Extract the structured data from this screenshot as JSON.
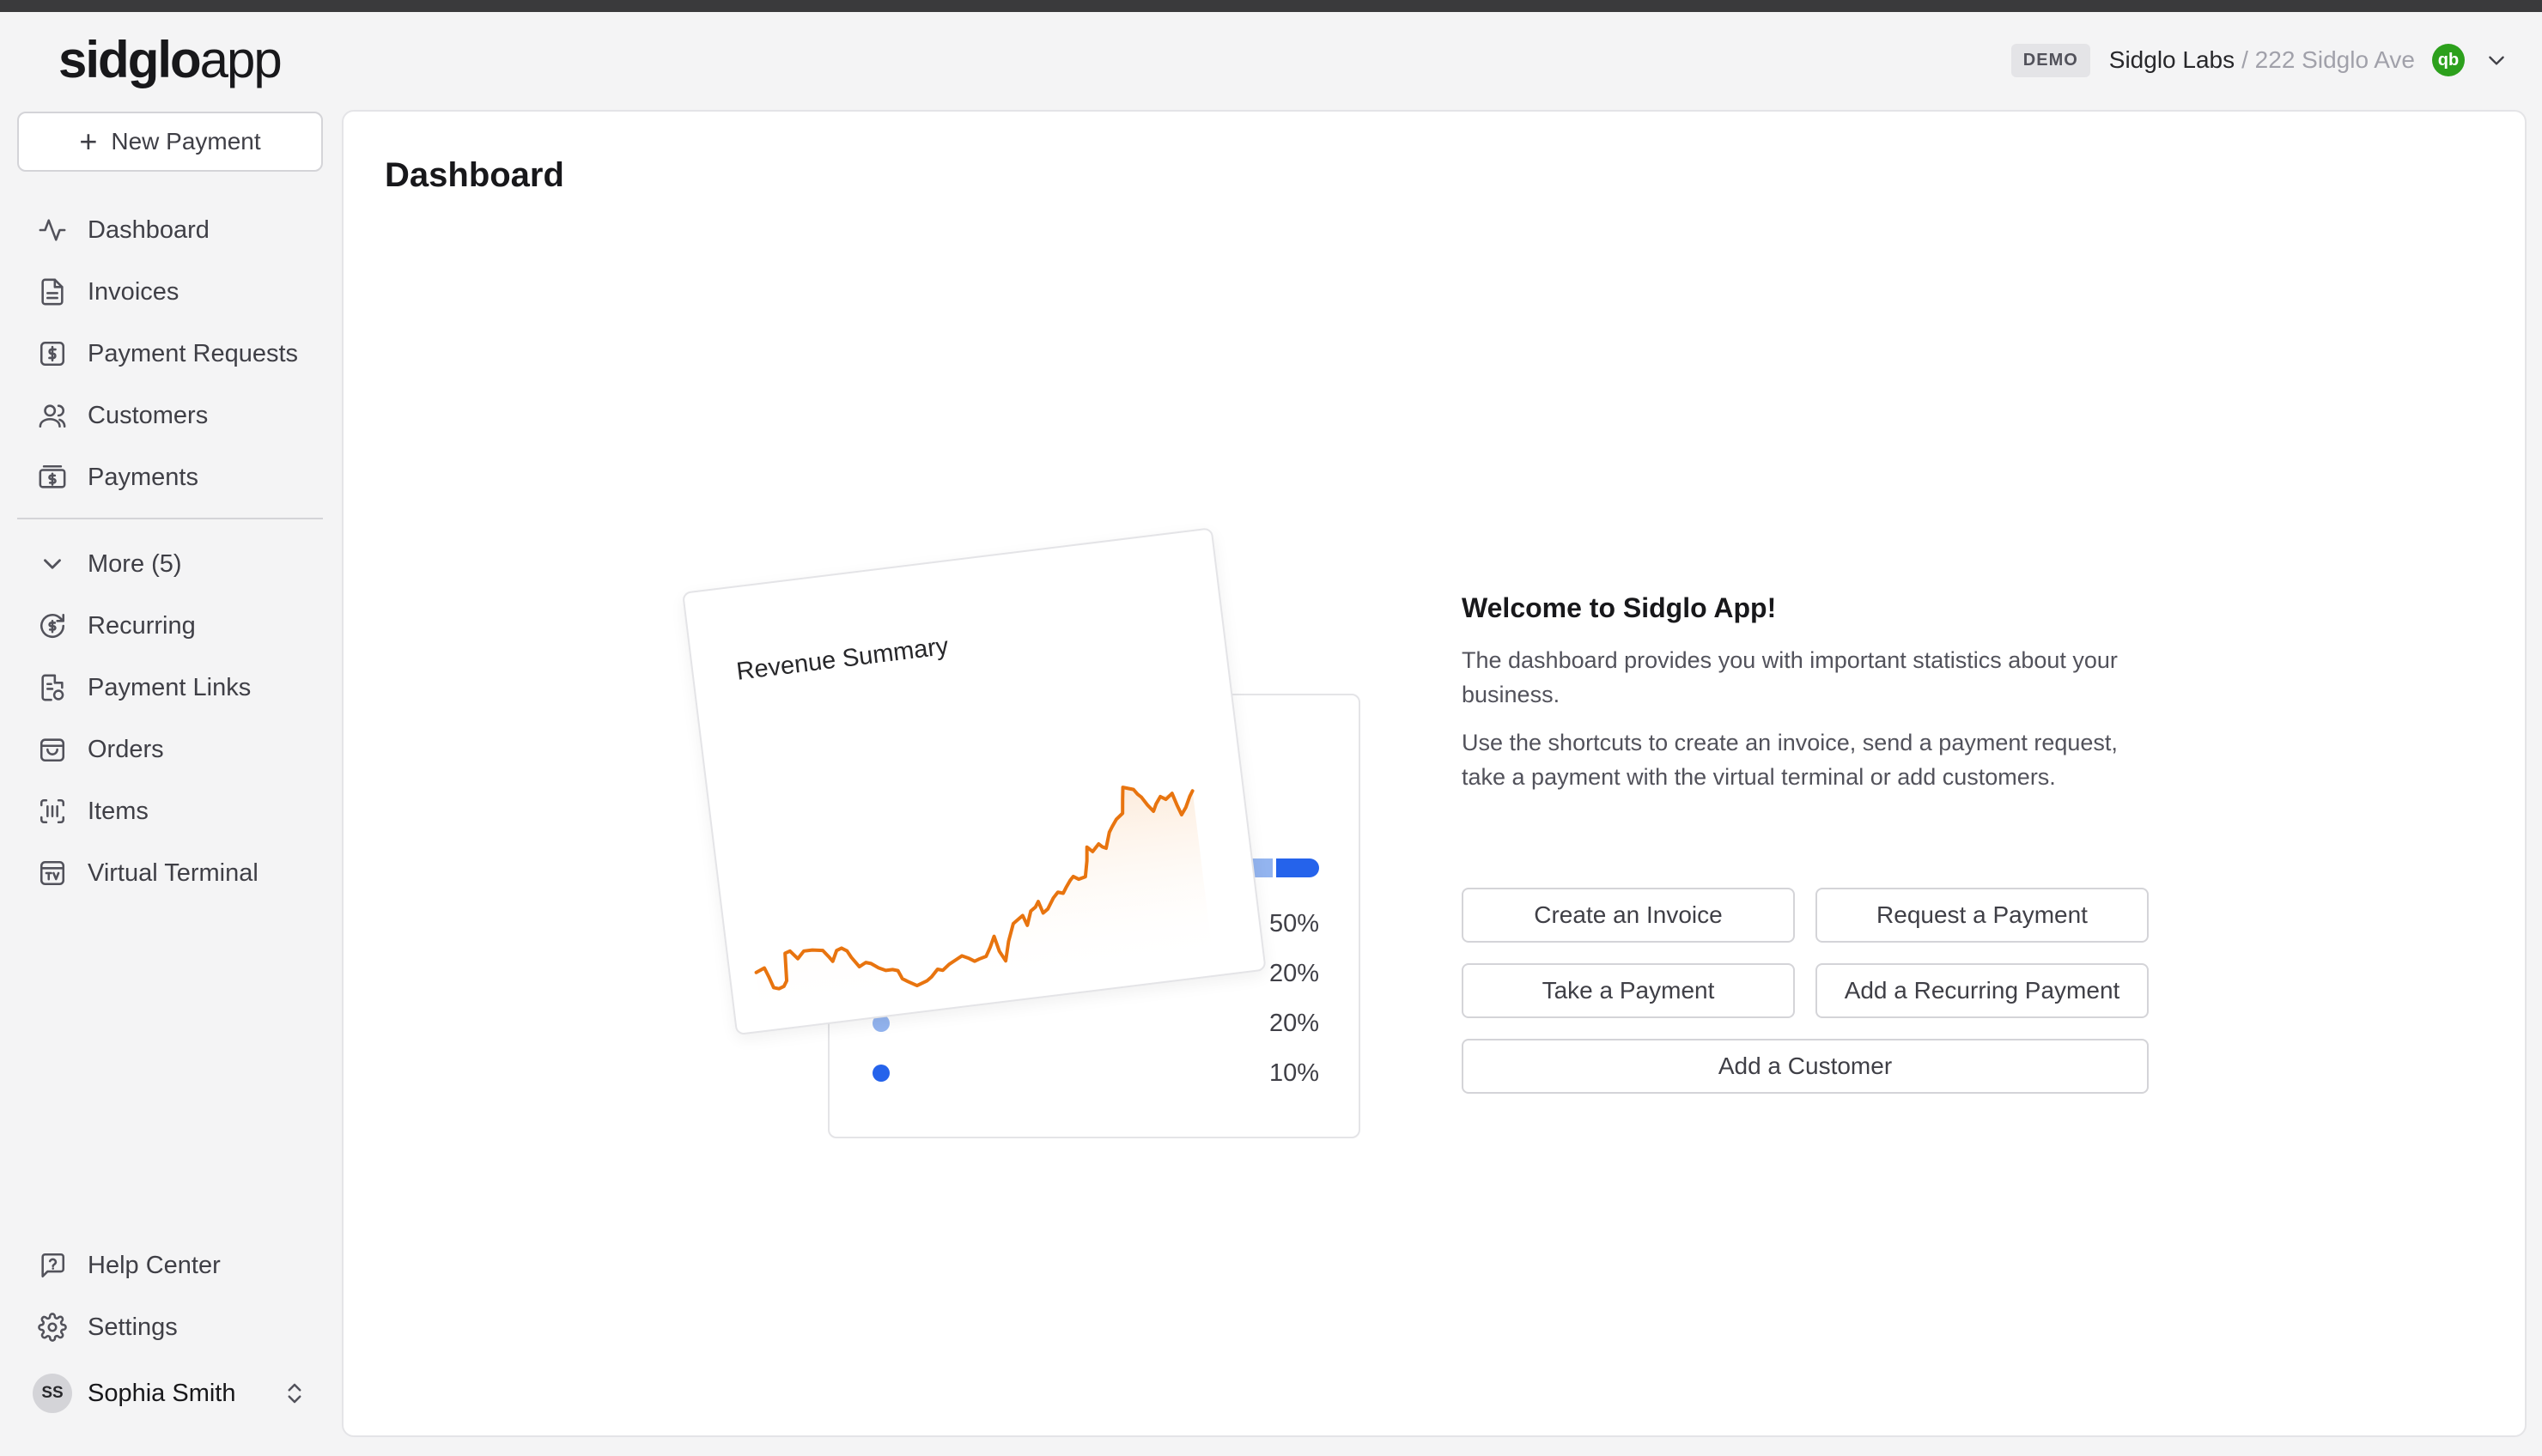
{
  "header": {
    "logo_bold": "sidglo",
    "logo_light": "app",
    "badge": "DEMO",
    "org": "Sidglo Labs",
    "location": "/ 222 Sidglo Ave",
    "integration_badge": "qb",
    "colors": {
      "integration": "#2ca01c"
    }
  },
  "sidebar": {
    "new_payment_label": "New Payment",
    "primary": [
      {
        "label": "Dashboard",
        "icon": "activity-icon"
      },
      {
        "label": "Invoices",
        "icon": "file-text-icon"
      },
      {
        "label": "Payment Requests",
        "icon": "dollar-request-icon"
      },
      {
        "label": "Customers",
        "icon": "users-icon"
      },
      {
        "label": "Payments",
        "icon": "banknote-icon"
      }
    ],
    "more_label": "More (5)",
    "more": [
      {
        "label": "Recurring",
        "icon": "recurring-dollar-icon"
      },
      {
        "label": "Payment Links",
        "icon": "file-link-icon"
      },
      {
        "label": "Orders",
        "icon": "bag-icon"
      },
      {
        "label": "Items",
        "icon": "barcode-scan-icon"
      },
      {
        "label": "Virtual Terminal",
        "icon": "terminal-icon"
      }
    ],
    "bottom": [
      {
        "label": "Help Center",
        "icon": "help-icon"
      },
      {
        "label": "Settings",
        "icon": "gear-icon"
      }
    ],
    "user": {
      "initials": "SS",
      "name": "Sophia Smith"
    }
  },
  "main": {
    "title": "Dashboard",
    "illustration": {
      "front_title": "Revenue Summary",
      "legend": [
        {
          "pct": "50%",
          "color": ""
        },
        {
          "pct": "20%",
          "color": ""
        },
        {
          "pct": "20%",
          "color": "#93b4ef"
        },
        {
          "pct": "10%",
          "color": "#2563eb"
        }
      ],
      "line_color": "#e8740f"
    },
    "welcome": {
      "heading": "Welcome to Sidglo App!",
      "p1": "The dashboard provides you with important statistics about your business.",
      "p2": "Use the shortcuts to create an invoice, send a payment request, take a payment with the virtual terminal or add customers."
    },
    "shortcuts": {
      "create_invoice": "Create an Invoice",
      "request_payment": "Request a Payment",
      "take_payment": "Take a Payment",
      "add_recurring": "Add a Recurring Payment",
      "add_customer": "Add a Customer"
    }
  }
}
